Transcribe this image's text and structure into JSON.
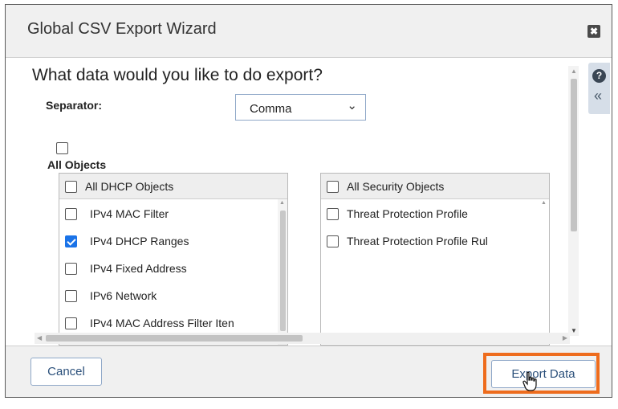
{
  "dialog": {
    "title": "Global CSV Export Wizard",
    "close_glyph": "✖"
  },
  "main": {
    "question": "What data would you like to do export?",
    "separator_label": "Separator:",
    "separator_value": "Comma",
    "all_objects_label": "All Objects",
    "all_objects_checked": false
  },
  "dhcp_panel": {
    "header": "All DHCP Objects",
    "header_checked": false,
    "items": [
      {
        "label": "IPv4 MAC Filter",
        "checked": false
      },
      {
        "label": "IPv4 DHCP Ranges",
        "checked": true
      },
      {
        "label": "IPv4 Fixed Address",
        "checked": false
      },
      {
        "label": "IPv6 Network",
        "checked": false
      },
      {
        "label": "IPv4 MAC Address Filter Iten",
        "checked": false
      }
    ]
  },
  "security_panel": {
    "header": "All Security Objects",
    "header_checked": false,
    "items": [
      {
        "label": "Threat Protection Profile",
        "checked": false
      },
      {
        "label": "Threat Protection Profile Rul",
        "checked": false
      }
    ]
  },
  "side": {
    "help_glyph": "?",
    "collapse_glyph": "«"
  },
  "footer": {
    "cancel_label": "Cancel",
    "export_label": "Export Data"
  },
  "colors": {
    "highlight": "#ee6c1d",
    "checkbox_checked": "#1a73e8"
  }
}
